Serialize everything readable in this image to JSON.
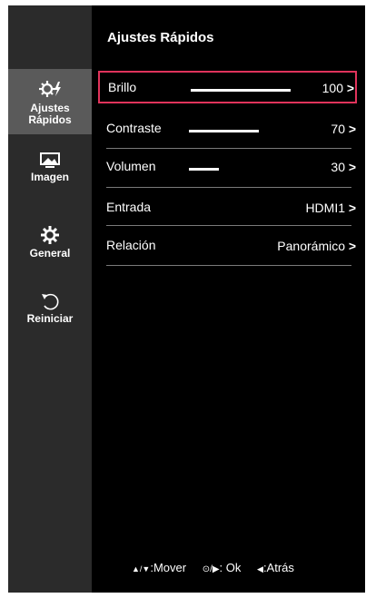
{
  "sidebar": {
    "items": [
      {
        "label_line1": "Ajustes",
        "label_line2": "Rápidos",
        "icon": "quick-settings-icon",
        "active": true
      },
      {
        "label": "Imagen",
        "icon": "picture-icon"
      },
      {
        "label": "General",
        "icon": "gear-icon"
      },
      {
        "label": "Reiniciar",
        "icon": "reset-icon"
      }
    ]
  },
  "header": {
    "title": "Ajustes Rápidos"
  },
  "menu": {
    "rows": [
      {
        "label": "Brillo",
        "value": "100",
        "level_percent": 100,
        "selected": true
      },
      {
        "label": "Contraste",
        "value": "70",
        "level_percent": 70
      },
      {
        "label": "Volumen",
        "value": "30",
        "level_percent": 30
      },
      {
        "label": "Entrada",
        "value": "HDMI1"
      },
      {
        "label": "Relación",
        "value": "Panorámico"
      }
    ],
    "chevron": ">"
  },
  "footer": {
    "move_keys": "▲/▼",
    "move_label": ":Mover",
    "ok_keys": "⊙/▶",
    "ok_label": ": Ok",
    "back_keys": "◀",
    "back_label": ":Atrás"
  },
  "colors": {
    "selection": "#e0335b",
    "background": "#000000",
    "sidebar": "#2b2b2b",
    "sidebar_active": "#5a5a5a"
  }
}
